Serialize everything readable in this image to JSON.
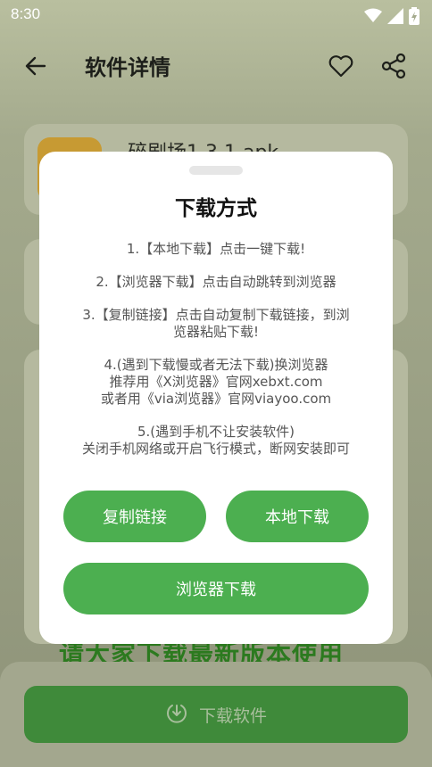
{
  "status_bar": {
    "time": "8:30",
    "icons": [
      "wifi-icon",
      "signal-icon",
      "battery-icon"
    ]
  },
  "header": {
    "title": "软件详情",
    "icons": [
      "back-arrow-icon",
      "heart-icon",
      "share-icon"
    ]
  },
  "background": {
    "file_name": "碎剧场1.3.1.apk",
    "banner_text": "请大家下载最新版本使用",
    "download_button_label": "下载软件"
  },
  "dialog": {
    "title": "下载方式",
    "instructions": [
      [
        "1.【本地下载】点击一键下载!"
      ],
      [
        "2.【浏览器下载】点击自动跳转到浏览器"
      ],
      [
        "3.【复制链接】点击自动复制下载链接，到浏",
        "览器粘贴下载!"
      ],
      [
        "4.(遇到下载慢或者无法下载)换浏览器",
        "推荐用《X浏览器》官网xebxt.com",
        "或者用《via浏览器》官网viayoo.com"
      ],
      [
        "5.(遇到手机不让安装软件)",
        "关闭手机网络或开启飞行模式，断网安装即可"
      ]
    ],
    "buttons": {
      "copy_link": "复制链接",
      "local_download": "本地下载",
      "browser_download": "浏览器下载"
    }
  },
  "colors": {
    "accent": "#4caf50",
    "download_bar": "#3f8a3a",
    "banner": "#2c7a1f"
  }
}
